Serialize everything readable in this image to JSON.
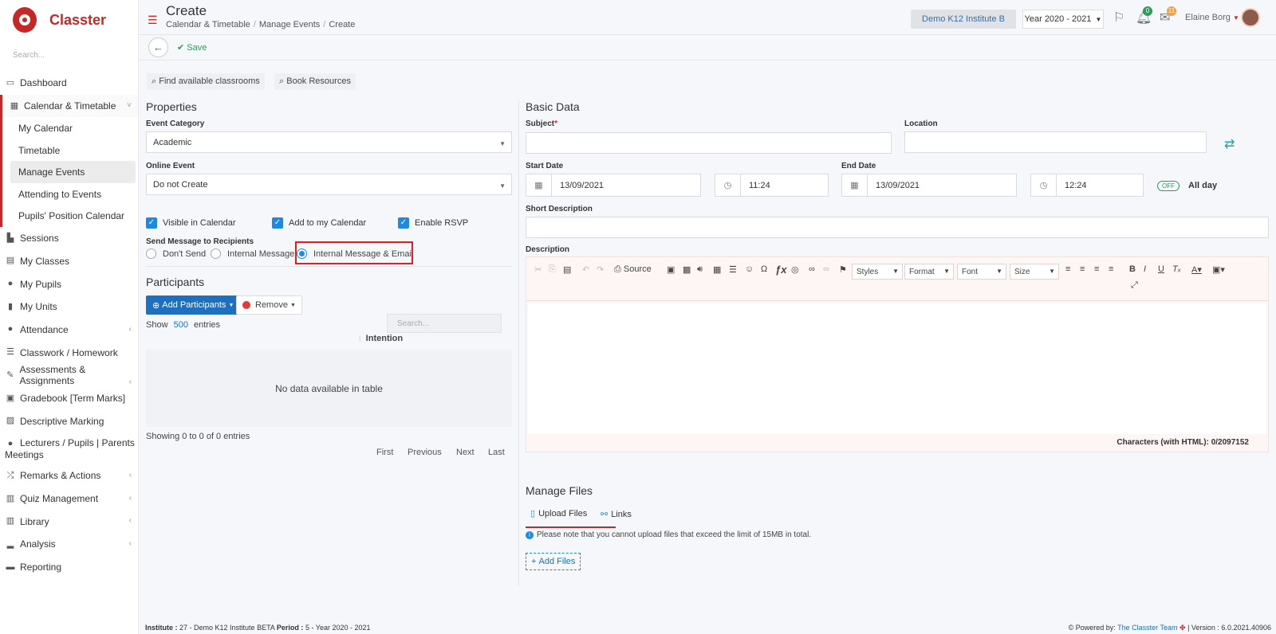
{
  "app": {
    "name": "Classter",
    "search_placeholder": "Search..."
  },
  "sidebar": {
    "items": [
      {
        "label": "Dashboard",
        "icon": "laptop-icon"
      },
      {
        "label": "Calendar & Timetable",
        "icon": "calendar-icon",
        "open": true,
        "sub": [
          "My Calendar",
          "Timetable",
          "Manage Events",
          "Attending to Events",
          "Pupils' Position Calendar"
        ]
      },
      {
        "label": "Sessions",
        "icon": "sessions-icon"
      },
      {
        "label": "My Classes",
        "icon": "classes-icon"
      },
      {
        "label": "My Pupils",
        "icon": "pupils-icon"
      },
      {
        "label": "My Units",
        "icon": "book-icon"
      },
      {
        "label": "Attendance",
        "icon": "attendance-icon"
      },
      {
        "label": "Classwork / Homework",
        "icon": "list-icon"
      },
      {
        "label": "Assessments & Assignments",
        "icon": "edit-icon"
      },
      {
        "label": "Gradebook [Term Marks]",
        "icon": "gradebook-icon"
      },
      {
        "label": "Descriptive Marking",
        "icon": "marking-icon"
      },
      {
        "label": "Lecturers / Pupils | Parents Meetings",
        "icon": "meetings-icon"
      },
      {
        "label": "Remarks & Actions",
        "icon": "shuffle-icon"
      },
      {
        "label": "Quiz Management",
        "icon": "quiz-icon"
      },
      {
        "label": "Library",
        "icon": "library-icon"
      },
      {
        "label": "Analysis",
        "icon": "chart-icon"
      },
      {
        "label": "Reporting",
        "icon": "printer-icon"
      }
    ],
    "active_sub": "Manage Events"
  },
  "header": {
    "title": "Create",
    "breadcrumb": [
      "Calendar & Timetable",
      "Manage Events",
      "Create"
    ],
    "institute": "Demo K12 Institute B",
    "year": "Year 2020 - 2021",
    "notif_count": "0",
    "mail_count": "11",
    "user": "Elaine Borg"
  },
  "toolbar": {
    "save_label": "Save"
  },
  "left": {
    "find_classrooms": "Find available classrooms",
    "book_resources": "Book Resources",
    "properties_title": "Properties",
    "event_category_label": "Event Category",
    "event_category_value": "Academic",
    "online_event_label": "Online Event",
    "online_event_value": "Do not Create",
    "checkboxes": [
      "Visible in Calendar",
      "Add to my Calendar",
      "Enable RSVP"
    ],
    "send_message_label": "Send Message to Recipients",
    "radios": [
      "Don't Send",
      "Internal Message",
      "Internal Message & Email"
    ],
    "radio_selected": "Internal Message & Email",
    "participants_title": "Participants",
    "add_participants": "Add Participants",
    "remove": "Remove",
    "show": "Show",
    "entries_count": "500",
    "entries": "entries",
    "table_search_placeholder": "Search...",
    "column_intention": "Intention",
    "no_data": "No data available in table",
    "showing": "Showing 0 to 0 of 0 entries",
    "pager": [
      "First",
      "Previous",
      "Next",
      "Last"
    ]
  },
  "right": {
    "basic_title": "Basic Data",
    "subject_label": "Subject",
    "required_mark": "*",
    "location_label": "Location",
    "start_label": "Start Date",
    "start_date": "13/09/2021",
    "start_time": "11:24",
    "end_label": "End Date",
    "end_date": "13/09/2021",
    "end_time": "12:24",
    "toggle_off": "OFF",
    "all_day": "All day",
    "short_desc_label": "Short Description",
    "desc_label": "Description",
    "editor_source": "Source",
    "editor_styles": "Styles",
    "editor_format": "Format",
    "editor_font": "Font",
    "editor_size": "Size",
    "char_count": "Characters (with HTML): 0/2097152",
    "files_title": "Manage Files",
    "tab_upload": "Upload Files",
    "tab_links": "Links",
    "note": "Please note that you cannot upload files that exceed the limit of 15MB in total.",
    "add_files": "Add Files"
  },
  "footer": {
    "institute_label": "Institute :",
    "institute_value": "27 - Demo K12 Institute BETA",
    "period_label": "Period :",
    "period_value": "5 - Year 2020 - 2021",
    "powered": "Powered by:",
    "team": "The Classter Team",
    "version": "| Version : 6.0.2021.40906"
  },
  "colors": {
    "brand": "#c62828",
    "accent": "#1e88e5",
    "save": "#2e9b57"
  }
}
